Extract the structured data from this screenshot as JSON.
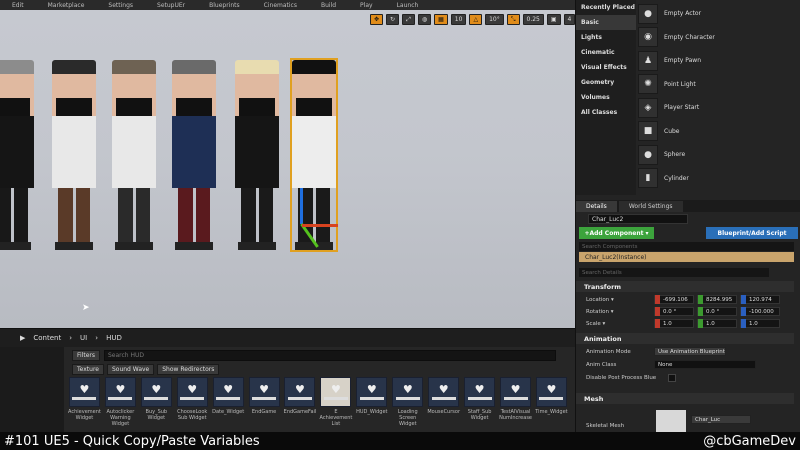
{
  "menu": [
    "Edit",
    "Marketplace",
    "Settings",
    "SetupUEr",
    "Blueprints",
    "Cinematics",
    "Build",
    "Play",
    "Launch"
  ],
  "viewport": {
    "toolbar": [
      "10",
      "10°",
      "0.25",
      "4"
    ],
    "characters": [
      {
        "hair": "#8c8c8c",
        "body": "#151515",
        "legs": "#181818"
      },
      {
        "hair": "#2a2a2a",
        "body": "#e8e8e8",
        "legs": "#5a3a28"
      },
      {
        "hair": "#6e6253",
        "body": "#e8e8e8",
        "legs": "#2a2a2a"
      },
      {
        "hair": "#6a6a6a",
        "body": "#1e2f55",
        "legs": "#5a1a1e"
      },
      {
        "hair": "#e8dcb0",
        "body": "#151515",
        "legs": "#1a1a1a"
      },
      {
        "hair": "#111111",
        "body": "#ededed",
        "legs": "#1a1a1a"
      }
    ]
  },
  "content_browser": {
    "breadcrumb": [
      "Content",
      "UI",
      "HUD"
    ],
    "filters_label": "Filters",
    "search_placeholder": "Search HUD",
    "tags": [
      "Texture",
      "Sound Wave",
      "Show Redirectors"
    ],
    "assets": [
      "Achievement Widget",
      "Autoclicker Warning Widget",
      "Buy_Sub Widget",
      "ChooseLook Sub Widget",
      "Date_Widget",
      "EndGame",
      "EndGameFail",
      "E Achievement List",
      "HUD_Widget",
      "Loading Screen Widget",
      "MouseCursor",
      "Staff_Sub Widget",
      "TestAIVisual NumIncrease",
      "Time_Widget"
    ]
  },
  "place_panel": {
    "categories": [
      "Recently Placed",
      "Basic",
      "Lights",
      "Cinematic",
      "Visual Effects",
      "Geometry",
      "Volumes",
      "All Classes"
    ],
    "active_category": "Basic",
    "items": [
      "Empty Actor",
      "Empty Character",
      "Empty Pawn",
      "Point Light",
      "Player Start",
      "Cube",
      "Sphere",
      "Cylinder"
    ]
  },
  "details": {
    "tabs": [
      "Details",
      "World Settings"
    ],
    "name": "Char_Luc2",
    "add_component": "+Add Component ▾",
    "blueprint_script": "Blueprint/Add Script",
    "search_components": "Search Components",
    "instance": "Char_Luc2(Instance)",
    "search_details": "Search Details",
    "transform_section": "Transform",
    "location_label": "Location ▾",
    "location": [
      "-699.106",
      "8284.995",
      "120.974"
    ],
    "rotation_label": "Rotation ▾",
    "rotation": [
      "0.0 °",
      "0.0 °",
      "-100.000"
    ],
    "scale_label": "Scale ▾",
    "scale": [
      "1.0",
      "1.0",
      "1.0"
    ],
    "animation_section": "Animation",
    "anim_mode_label": "Animation Mode",
    "anim_mode_value": "Use Animation Blueprint",
    "anim_class_label": "Anim Class",
    "anim_class_value": "None",
    "disable_pp_label": "Disable Post Process Blue",
    "mesh_section": "Mesh",
    "skeletal_mesh_label": "Skeletal Mesh",
    "skeletal_mesh_value": "Char_Luc"
  },
  "caption": {
    "title": "#101 UE5 - Quick Copy/Paste Variables",
    "handle": "@cbGameDev"
  },
  "colors": {
    "accent": "#e08c1a",
    "add_green": "#3ca33c",
    "blueprint_blue": "#2a6fb8",
    "selection_tan": "#c9a46c"
  }
}
